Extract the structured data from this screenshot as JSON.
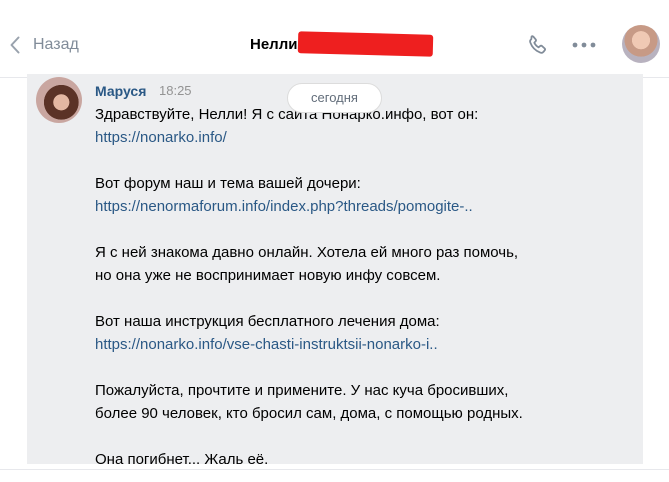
{
  "header": {
    "back_label": "Назад",
    "chat_title": "Нелли"
  },
  "date_divider": "сегодня",
  "message": {
    "author": "Маруся",
    "time": "18:25",
    "paragraphs": [
      {
        "text": "Здравствуйте, Нелли! Я с сайта Нонарко.инфо, вот он:",
        "link": "https://nonarko.info/"
      },
      {
        "text": "Вот форум наш и тема вашей дочери:",
        "link": "https://nenormaforum.info/index.php?threads/pomogite-.."
      },
      {
        "text": "Я с ней знакома давно онлайн. Хотела ей много раз помочь,",
        "text2": "но она уже не воспринимает новую инфу совсем."
      },
      {
        "text": "Вот наша инструкция бесплатного лечения дома:",
        "link": "https://nonarko.info/vse-chasti-instruktsii-nonarko-i.."
      },
      {
        "text": "Пожалуйста, прочтите и примените. У нас куча бросивших,",
        "text2": "более 90 человек, кто бросил сам, дома, с помощью родных."
      },
      {
        "text": "Она погибнет... Жаль её."
      }
    ]
  },
  "colors": {
    "link": "#2a5885",
    "message_bg": "#edeef0",
    "redaction": "#ee1f1f",
    "icon": "#818c99"
  },
  "icons": {
    "back": "chevron-left-icon",
    "call": "phone-icon",
    "more": "more-horizontal-icon"
  }
}
